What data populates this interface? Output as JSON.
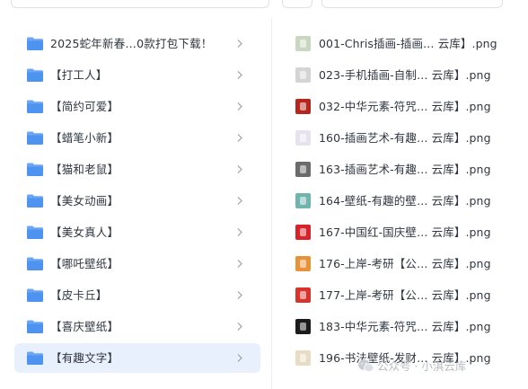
{
  "folders": [
    {
      "label": "2025蛇年新春…0款打包下载！"
    },
    {
      "label": "【打工人】"
    },
    {
      "label": "【简约可爱】"
    },
    {
      "label": "【蜡笔小新】"
    },
    {
      "label": "【猫和老鼠】"
    },
    {
      "label": "【美女动画】"
    },
    {
      "label": "【美女真人】"
    },
    {
      "label": "【哪吒壁纸】"
    },
    {
      "label": "【皮卡丘】"
    },
    {
      "label": "【喜庆壁纸】"
    },
    {
      "label": "【有趣文字】"
    }
  ],
  "selected_folder_index": 10,
  "files": [
    {
      "name": "001-Chris插画-插画… 云库】.png",
      "thumb_color": "#c9d7c0"
    },
    {
      "name": "023-手机插画-自制… 云库】.png",
      "thumb_color": "#d4d4d4"
    },
    {
      "name": "032-中华元素-符咒… 云库】.png",
      "thumb_color": "#b4261e"
    },
    {
      "name": "160-插画艺术-有趣… 云库】.png",
      "thumb_color": "#e6e3ef"
    },
    {
      "name": "163-插画艺术-有趣… 云库】.png",
      "thumb_color": "#6b6b6b"
    },
    {
      "name": "164-壁纸-有趣的壁… 云库】.png",
      "thumb_color": "#6fb4ae"
    },
    {
      "name": "167-中国红-国庆壁… 云库】.png",
      "thumb_color": "#d8232a"
    },
    {
      "name": "176-上岸-考研【公… 云库】.png",
      "thumb_color": "#e8923a"
    },
    {
      "name": "177-上岸-考研【公… 云库】.png",
      "thumb_color": "#d9342b"
    },
    {
      "name": "183-中华元素-符咒… 云库】.png",
      "thumb_color": "#1c1c1c"
    },
    {
      "name": "196-书法壁纸-发财… 云库】.png",
      "thumb_color": "#e8dcc4"
    }
  ],
  "watermark": "公众号 · 小淇云库",
  "colors": {
    "accent": "#4e8ef7",
    "selected_bg": "#e9f0fd",
    "folder": "#5b9cf2"
  }
}
